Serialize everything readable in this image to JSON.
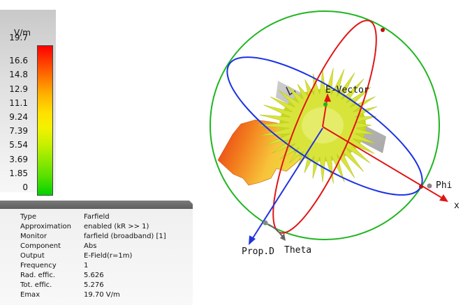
{
  "legend": {
    "unit": "V/m",
    "ticks": [
      "19.7",
      "16.6",
      "14.8",
      "12.9",
      "11.1",
      "9.24",
      "7.39",
      "5.54",
      "3.69",
      "1.85",
      "0"
    ]
  },
  "info": {
    "rows": [
      {
        "key": "Type",
        "value": "Farfield"
      },
      {
        "key": "Approximation",
        "value": "enabled (kR >> 1)"
      },
      {
        "key": "Monitor",
        "value": "farfield (broadband) [1]"
      },
      {
        "key": "Component",
        "value": "Abs"
      },
      {
        "key": "Output",
        "value": "E-Field(r=1m)"
      },
      {
        "key": "Frequency",
        "value": "1"
      },
      {
        "key": "Rad. effic.",
        "value": "5.626"
      },
      {
        "key": "Tot. effic.",
        "value": "5.276"
      },
      {
        "key": "Emax",
        "value": "19.70 V/m"
      }
    ]
  },
  "scene": {
    "labels": {
      "e_vector": "E-Vector",
      "phi": "Phi",
      "x_axis": "x",
      "prop_direction": "Prop.D",
      "theta": "Theta"
    },
    "colors": {
      "sphere": "#1fb51f",
      "phi_ring": "#1a32e6",
      "theta_ring": "#e01515",
      "x_axis": "#e01515",
      "prop_arrow": "#2233dd"
    }
  }
}
